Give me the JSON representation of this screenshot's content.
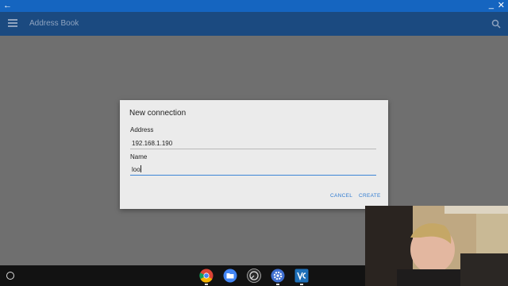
{
  "window": {
    "back_icon": "arrow-left-icon",
    "minimize_icon": "minimize-icon",
    "close_icon": "close-icon"
  },
  "appbar": {
    "title": "Address Book",
    "menu_icon": "hamburger-menu-icon",
    "search_icon": "search-icon"
  },
  "dialog": {
    "title": "New connection",
    "address_label": "Address",
    "address_value": "192.168.1.190",
    "name_label": "Name",
    "name_value": "loo",
    "cancel_label": "CANCEL",
    "create_label": "CREATE"
  },
  "shelf": {
    "launcher_icon": "launcher-circle-icon",
    "apps": [
      "chrome-icon",
      "files-icon",
      "audio-player-icon",
      "settings-gear-icon",
      "vnc-viewer-icon"
    ]
  },
  "colors": {
    "titlebar": "#1565c0",
    "appbar": "#1b4a80",
    "accent": "#2f7bd1",
    "backdrop": "#6f6f6f",
    "dialog": "#ebebeb"
  }
}
